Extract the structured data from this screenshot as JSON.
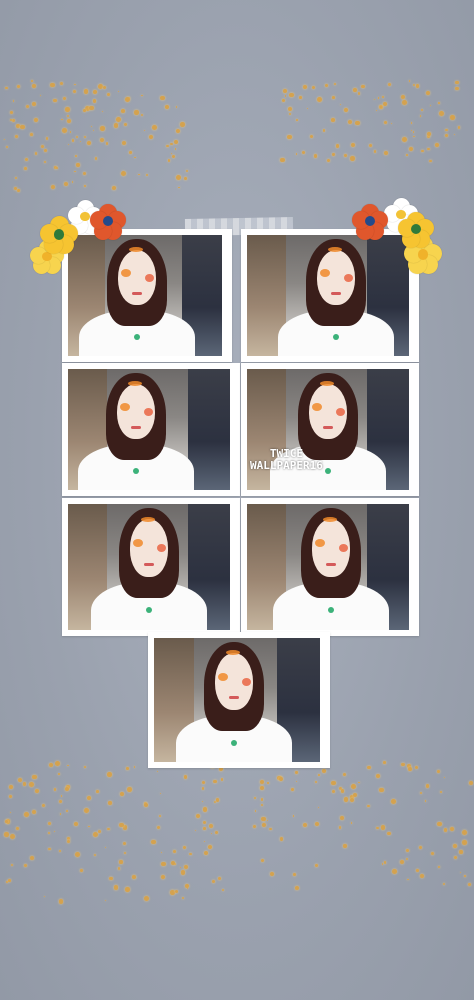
{
  "wallpaper": {
    "watermark_line1": "TWICE",
    "watermark_line2": "WALLPAPER16",
    "background_color": "#9aa1ae",
    "accent_color": "#d4a24f"
  },
  "flowers": [
    {
      "name": "yellow-flower-icon",
      "color": "#f6c431",
      "center": "#2f7a3a"
    },
    {
      "name": "white-flower-icon",
      "color": "#ffffff",
      "center": "#f2c236"
    },
    {
      "name": "red-flower-icon",
      "color": "#e0572c",
      "center": "#244a8a"
    },
    {
      "name": "yellow-flower-icon",
      "color": "#f7d44e",
      "center": "#f0b22a"
    }
  ],
  "decor": {
    "tape": "washi-tape",
    "film_strip": "photo-strip"
  }
}
